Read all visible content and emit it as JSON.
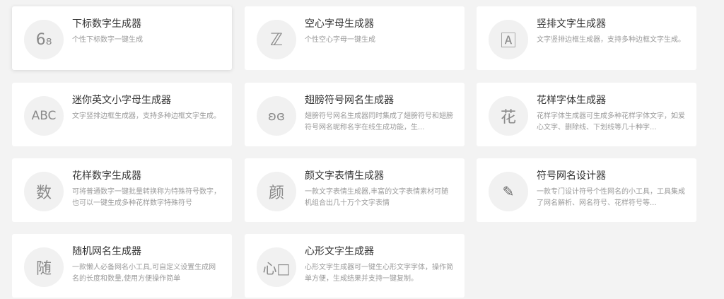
{
  "tools": [
    {
      "title": "下标数字生成器",
      "desc": "个性下标数字一键生成",
      "icon_text": "6₈",
      "icon": "subscript-digit-icon"
    },
    {
      "title": "空心字母生成器",
      "desc": "个性空心字母一键生成",
      "icon_text": "ℤ",
      "icon": "hollow-letter-icon"
    },
    {
      "title": "竖排文字生成器",
      "desc": "文字竖排边框生成器，支持多种边框文字生成。",
      "icon_text": "🄰",
      "icon": "boxed-letter-icon"
    },
    {
      "title": "迷你英文小字母生成器",
      "desc": "文字竖排边框生成器，支持多种边框文字生成。",
      "icon_text": "ABC",
      "icon": "abc-icon"
    },
    {
      "title": "翅膀符号网名生成器",
      "desc": "翅膀符号网名生成器同时集成了翅膀符号和翅膀符号网名昵称名字在线生成功能，生...",
      "icon_text": "ʚɞ",
      "icon": "wings-icon"
    },
    {
      "title": "花样字体生成器",
      "desc": "花样字体生成器可生成多种花样字体文字，如爱心文字、删除线、下划线等几十种字...",
      "icon_text": "花",
      "icon": "flower-char-icon"
    },
    {
      "title": "花样数字生成器",
      "desc": "可将普通数字一键批量转换称为特殊符号数字，也可以一键生成多种花样数字特殊符号",
      "icon_text": "数",
      "icon": "number-char-icon"
    },
    {
      "title": "颜文字表情生成器",
      "desc": "一款文字表情生成器,丰富的文字表情素材可随机组合出几十万个文字表情",
      "icon_text": "颜",
      "icon": "face-char-icon"
    },
    {
      "title": "符号网名设计器",
      "desc": "一款专门设计符号个性网名的小工具，工具集成了网名解析、网名符号、花样符号等...",
      "icon_text": "✎",
      "icon": "pencil-icon"
    },
    {
      "title": "随机网名生成器",
      "desc": "一款懒人必备网名小工具,可自定义设置生成网名的长度和数量,使用方便操作简单",
      "icon_text": "随",
      "icon": "random-char-icon"
    },
    {
      "title": "心形文字生成器",
      "desc": "心形文字生成器可一键生心形文字字体，操作简单方便，生成结果并支持一键复制。",
      "icon_text": "心□",
      "icon": "heart-char-icon"
    }
  ]
}
